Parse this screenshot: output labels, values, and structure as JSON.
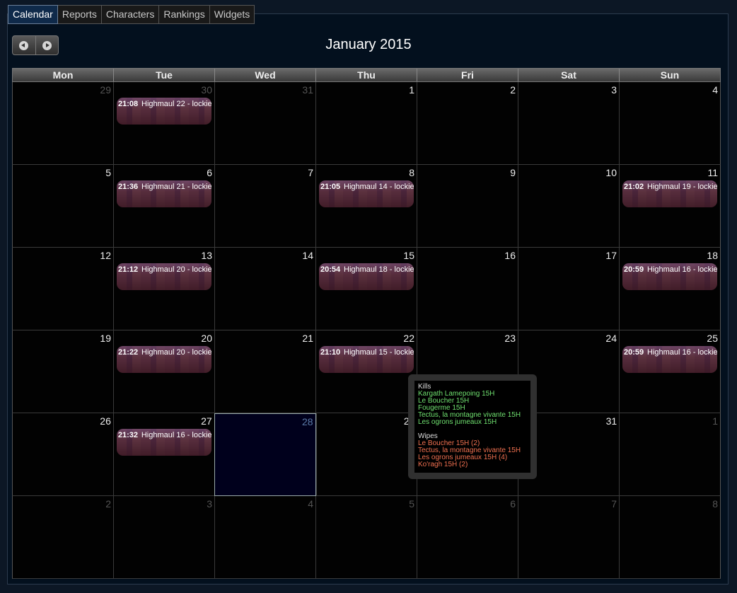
{
  "tabs": [
    "Calendar",
    "Reports",
    "Characters",
    "Rankings",
    "Widgets"
  ],
  "header": {
    "title": "January 2015"
  },
  "weekdays": [
    "Mon",
    "Tue",
    "Wed",
    "Thu",
    "Fri",
    "Sat",
    "Sun"
  ],
  "weeks": [
    [
      {
        "day": "29",
        "other": true
      },
      {
        "day": "30",
        "other": true,
        "event": {
          "time": "21:08",
          "title": "Highmaul 22 - lockie"
        }
      },
      {
        "day": "31",
        "other": true
      },
      {
        "day": "1"
      },
      {
        "day": "2"
      },
      {
        "day": "3"
      },
      {
        "day": "4"
      }
    ],
    [
      {
        "day": "5"
      },
      {
        "day": "6",
        "event": {
          "time": "21:36",
          "title": "Highmaul 21 - lockie"
        }
      },
      {
        "day": "7"
      },
      {
        "day": "8",
        "event": {
          "time": "21:05",
          "title": "Highmaul 14 - lockie"
        }
      },
      {
        "day": "9"
      },
      {
        "day": "10"
      },
      {
        "day": "11",
        "event": {
          "time": "21:02",
          "title": "Highmaul 19 - lockie"
        }
      }
    ],
    [
      {
        "day": "12"
      },
      {
        "day": "13",
        "event": {
          "time": "21:12",
          "title": "Highmaul 20 - lockie"
        }
      },
      {
        "day": "14"
      },
      {
        "day": "15",
        "event": {
          "time": "20:54",
          "title": "Highmaul 18 - lockie"
        }
      },
      {
        "day": "16"
      },
      {
        "day": "17"
      },
      {
        "day": "18",
        "event": {
          "time": "20:59",
          "title": "Highmaul 16 - lockie"
        }
      }
    ],
    [
      {
        "day": "19"
      },
      {
        "day": "20",
        "event": {
          "time": "21:22",
          "title": "Highmaul 20 - lockie"
        }
      },
      {
        "day": "21"
      },
      {
        "day": "22",
        "event": {
          "time": "21:10",
          "title": "Highmaul 15 - lockie"
        }
      },
      {
        "day": "23"
      },
      {
        "day": "24"
      },
      {
        "day": "25",
        "event": {
          "time": "20:59",
          "title": "Highmaul 16 - lockie"
        }
      }
    ],
    [
      {
        "day": "26"
      },
      {
        "day": "27",
        "event": {
          "time": "21:32",
          "title": "Highmaul 16 - lockie"
        }
      },
      {
        "day": "28",
        "today": true
      },
      {
        "day": "29"
      },
      {
        "day": "30"
      },
      {
        "day": "31"
      },
      {
        "day": "1",
        "other": true
      }
    ],
    [
      {
        "day": "2",
        "other": true
      },
      {
        "day": "3",
        "other": true
      },
      {
        "day": "4",
        "other": true
      },
      {
        "day": "5",
        "other": true
      },
      {
        "day": "6",
        "other": true
      },
      {
        "day": "7",
        "other": true
      },
      {
        "day": "8",
        "other": true
      }
    ]
  ],
  "tooltip": {
    "kills_label": "Kills",
    "kills": [
      "Kargath Lamepoing 15H",
      "Le Boucher 15H",
      "Fougerme 15H",
      "Tectus, la montagne vivante 15H",
      "Les ogrons jumeaux 15H"
    ],
    "wipes_label": "Wipes",
    "wipes": [
      "Le Boucher 15H (2)",
      "Tectus, la montagne vivante 15H",
      "Les ogrons jumeaux 15H (4)",
      "Ko'ragh 15H (2)"
    ]
  },
  "colors": {
    "kill": "#6fe06f",
    "wipe": "#f07050",
    "active_tab": "#0f2a4a"
  },
  "icons": {
    "prev": "chevron-left-icon",
    "next": "chevron-right-icon"
  }
}
